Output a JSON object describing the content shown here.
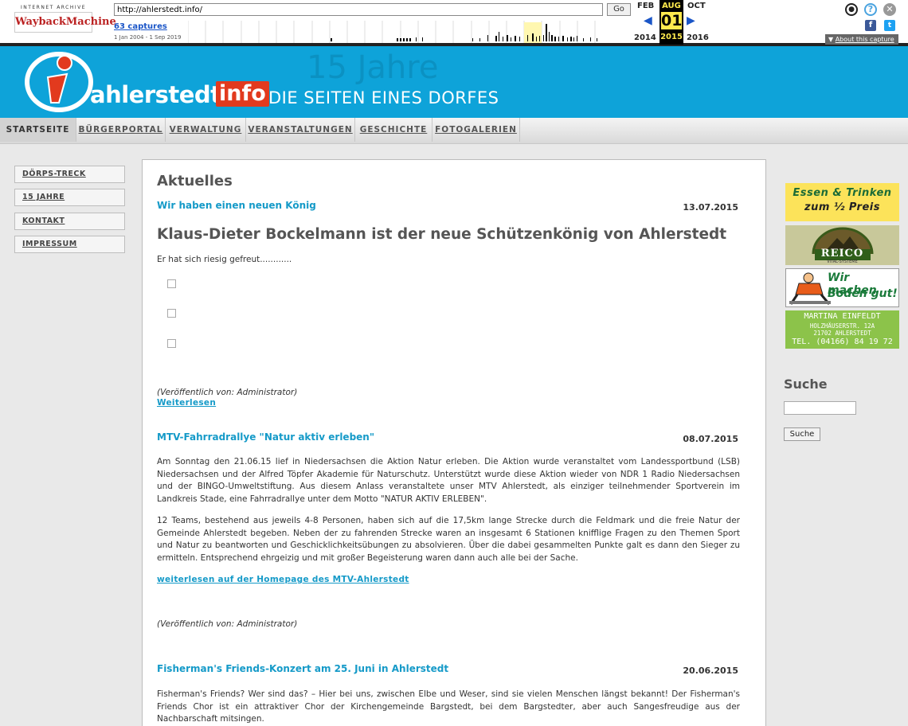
{
  "wayback": {
    "logo_top": "INTERNET ARCHIVE",
    "logo_main": "WaybackMachine",
    "url": "http://ahlerstedt.info/",
    "go_label": "Go",
    "captures": "63 captures",
    "range": "1 Jan 2004 - 1 Sep 2019",
    "prev_month": "FEB",
    "cur_month": "AUG",
    "next_month": "OCT",
    "cur_day": "01",
    "prev_year": "2014",
    "cur_year": "2015",
    "next_year": "2016",
    "about": "About this capture"
  },
  "header": {
    "site_name": "ahlerstedt.",
    "site_tld": "info",
    "slogan": "DIE SEITEN EINES DORFES",
    "jubilee": "15 Jahre"
  },
  "nav": {
    "items": [
      "STARTSEITE",
      "BÜRGERPORTAL",
      "VERWALTUNG",
      "VERANSTALTUNGEN",
      "GESCHICHTE",
      "FOTOGALERIEN"
    ]
  },
  "sidebar": {
    "items": [
      "DÖRPS-TRECK",
      "15 JAHRE",
      "KONTAKT",
      "IMPRESSUM"
    ]
  },
  "main": {
    "heading": "Aktuelles",
    "articles": [
      {
        "title": "Wir haben einen neuen König",
        "date": "13.07.2015",
        "headline": "Klaus-Dieter Bockelmann ist der neue Schützenkönig von Ahlerstedt",
        "text": "Er hat sich riesig gefreut............",
        "published": "(Veröffentlich von: Administrator)",
        "more": "Weiterlesen"
      },
      {
        "title": "MTV-Fahrradrallye \"Natur aktiv erleben\"",
        "date": "08.07.2015",
        "p1": "Am Sonntag den 21.06.15 lief in Niedersachsen die Aktion Natur erleben. Die Aktion wurde veranstaltet vom Landessportbund (LSB) Niedersachsen und der Alfred Töpfer Akademie für Naturschutz. Unterstützt wurde diese Aktion wieder von NDR 1 Radio Niedersachsen und der BINGO-Umweltstiftung. Aus diesem Anlass veranstaltete unser MTV Ahlerstedt, als einziger teilnehmender Sportverein im Landkreis Stade, eine Fahrradrallye unter dem Motto \"NATUR AKTIV ERLEBEN\".",
        "p2": "12 Teams, bestehend aus jeweils 4-8 Personen, haben sich auf die 17,5km lange Strecke durch die Feldmark  und die freie Natur der Gemeinde Ahlerstedt begeben.  Neben der zu fahrenden Strecke waren an insgesamt 6 Stationen knifflige Fragen zu den Themen Sport und Natur zu beantworten und Geschicklichkeitsübungen zu absolvieren. Über die dabei gesammelten Punkte galt es dann den Sieger zu ermitteln. Entsprechend ehrgeizig und mit großer Begeisterung waren dann auch alle bei der Sache.",
        "more": "weiterlesen auf der Homepage des MTV-Ahlerstedt",
        "published": "(Veröffentlich von: Administrator)"
      },
      {
        "title": "Fisherman's Friends-Konzert am 25. Juni in Ahlerstedt",
        "date": "20.06.2015",
        "p1": "Fisherman's Friends? Wer sind das? – Hier bei uns, zwischen Elbe und Weser, sind sie vielen Menschen längst bekannt! Der Fisherman's Friends Chor ist ein attraktiver Chor der Kirchengemeinde Bargstedt, bei dem Bargstedter, aber auch Sangesfreudige aus der Nachbarschaft mitsingen."
      }
    ]
  },
  "ads": {
    "essen_line1": "Essen & Trinken",
    "essen_line2": "zum ½ Preis",
    "reico": "REICO",
    "reico_sub": "VITAL-SYSTEME",
    "boden_line1": "Wir machen",
    "boden_line2": "Boden gut!",
    "einfeldt_name": "MARTINA EINFELDT",
    "einfeldt_street": "HOLZHÄUSERSTR. 12A",
    "einfeldt_city": "21702 AHLERSTEDT",
    "einfeldt_tel": "TEL. (04166) 84 19 72"
  },
  "search": {
    "heading": "Suche",
    "button": "Suche"
  }
}
